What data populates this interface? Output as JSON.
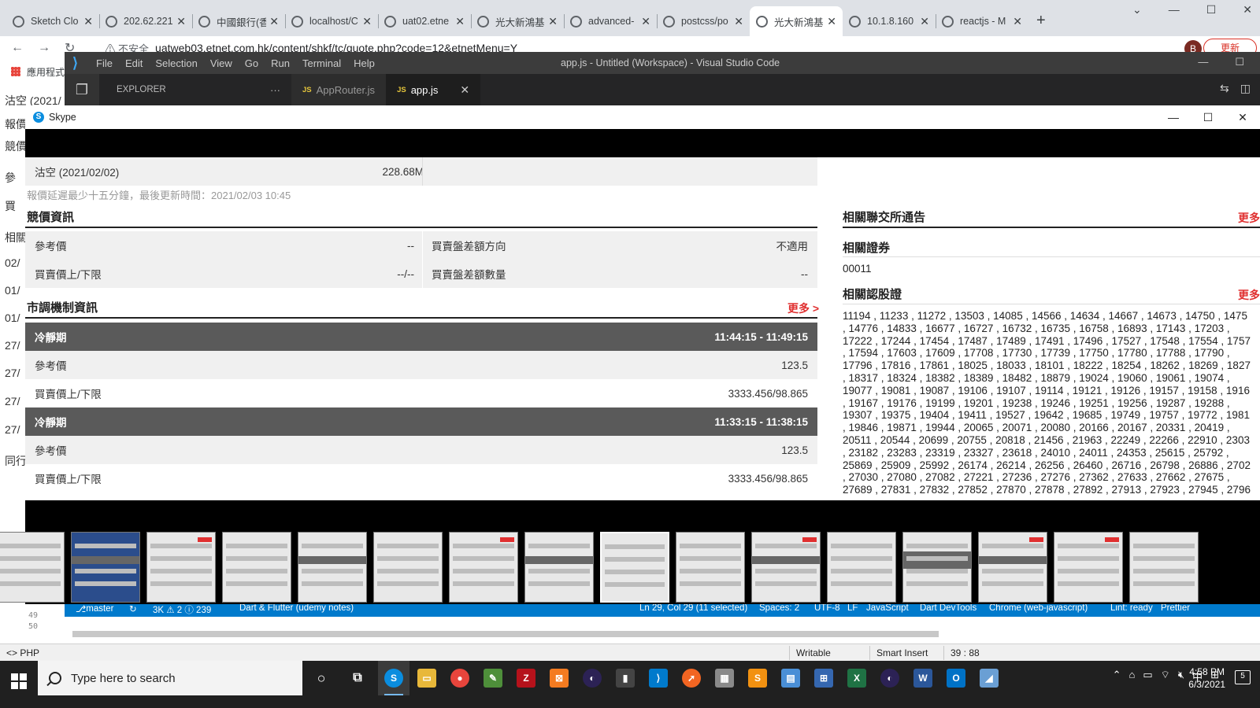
{
  "chrome": {
    "tabs": [
      {
        "title": "Sketch Clo"
      },
      {
        "title": "202.62.221"
      },
      {
        "title": "中國銀行(香"
      },
      {
        "title": "localhost/C"
      },
      {
        "title": "uat02.etne"
      },
      {
        "title": "光大新鴻基"
      },
      {
        "title": "advanced-"
      },
      {
        "title": "postcss/po"
      },
      {
        "title": "光大新鴻基",
        "active": true
      },
      {
        "title": "10.1.8.160"
      },
      {
        "title": "reactjs - M"
      }
    ],
    "new_tab": "+",
    "insecure_label": "不安全",
    "url": "uatweb03.etnet.com.hk/content/shkf/tc/quote.php?code=12&etnetMenu=Y",
    "profile_initial": "B",
    "update_label": "更新",
    "bookmark_apps": "應用程式"
  },
  "background_page": {
    "lines": [
      "沽空 (2021/",
      "報價",
      "競價",
      "參",
      "買",
      "相關",
      "02/",
      "01/",
      "01/",
      "27/",
      "27/",
      "27/",
      "27/",
      "同行"
    ]
  },
  "vscode": {
    "menu": [
      "File",
      "Edit",
      "Selection",
      "View",
      "Go",
      "Run",
      "Terminal",
      "Help"
    ],
    "title": "app.js - Untitled (Workspace) - Visual Studio Code",
    "explorer_label": "EXPLORER",
    "explorer_more": "···",
    "tabs": [
      {
        "badge": "JS",
        "label": "AppRouter.js"
      },
      {
        "badge": "JS",
        "label": "app.js",
        "active": true
      }
    ],
    "gutter_lines": [
      "49",
      "50"
    ],
    "status": {
      "branch": "master",
      "problems": "3K ⚠ 2 ⓘ 239",
      "project": "Dart & Flutter (udemy notes)",
      "cursor": "Ln 29, Col 29 (11 selected)",
      "spaces": "Spaces: 2",
      "encoding": "UTF-8",
      "eol": "LF",
      "language": "JavaScript",
      "devtools": "Dart DevTools",
      "debug": "Chrome (web-javascript)",
      "lint": "Lint: ready",
      "prettier": "Prettier"
    }
  },
  "php_status": {
    "language": "PHP",
    "writable": "Writable",
    "insert_mode": "Smart Insert",
    "position": "39 : 88"
  },
  "skype": {
    "title": "Skype",
    "shared": {
      "short_sell": {
        "label": "沽空 (2021/02/02)",
        "value": "228.68M"
      },
      "delay_note": "報價延遲最少十五分鐘，最後更新時間：2021/02/03 10:45",
      "auction": {
        "title": "競價資訊",
        "rows": [
          {
            "left_label": "參考價",
            "left_value": "--",
            "right_label": "買賣盤差額方向",
            "right_value": "不適用"
          },
          {
            "left_label": "買賣價上/下限",
            "left_value": "--/--",
            "right_label": "買賣盤差額數量",
            "right_value": "--"
          }
        ]
      },
      "vcm": {
        "title": "市調機制資訊",
        "more": "更多 >",
        "blocks": [
          {
            "period_label": "冷靜期",
            "period": "11:44:15 - 11:49:15",
            "ref_label": "參考價",
            "ref": "123.5",
            "limit_label": "買賣價上/下限",
            "limit": "3333.456/98.865"
          },
          {
            "period_label": "冷靜期",
            "period": "11:33:15 - 11:38:15",
            "ref_label": "參考價",
            "ref": "123.5",
            "limit_label": "買賣價上/下限",
            "limit": "3333.456/98.865"
          }
        ]
      },
      "exchange_notice": {
        "title": "相關聯交所通告",
        "more": "更多"
      },
      "related_securities": {
        "title": "相關證券",
        "value": "00011"
      },
      "related_warrants": {
        "title": "相關認股證",
        "more": "更多",
        "text": "11194 , 11233 , 11272 , 13503 , 14085 , 14566 , 14634 , 14667 , 14673 , 14750 , 1475\n, 14776 , 14833 , 16677 , 16727 , 16732 , 16735 , 16758 , 16893 , 17143 , 17203 ,\n17222 , 17244 , 17454 , 17487 , 17489 , 17491 , 17496 , 17527 , 17548 , 17554 , 1757\n, 17594 , 17603 , 17609 , 17708 , 17730 , 17739 , 17750 , 17780 , 17788 , 17790 ,\n17796 , 17816 , 17861 , 18025 , 18033 , 18101 , 18222 , 18254 , 18262 , 18269 , 1827\n, 18317 , 18324 , 18382 , 18389 , 18482 , 18879 , 19024 , 19060 , 19061 , 19074 ,\n19077 , 19081 , 19087 , 19106 , 19107 , 19114 , 19121 , 19126 , 19157 , 19158 , 1916\n, 19167 , 19176 , 19199 , 19201 , 19238 , 19246 , 19251 , 19256 , 19287 , 19288 ,\n19307 , 19375 , 19404 , 19411 , 19527 , 19642 , 19685 , 19749 , 19757 , 19772 , 1981\n, 19846 , 19871 , 19944 , 20065 , 20071 , 20080 , 20166 , 20167 , 20331 , 20419 ,\n20511 , 20544 , 20699 , 20755 , 20818 , 21456 , 21963 , 22249 , 22266 , 22910 , 2303\n, 23182 , 23283 , 23319 , 23327 , 23618 , 24010 , 24011 , 24353 , 25615 , 25792 ,\n25869 , 25909 , 25992 , 26174 , 26214 , 26256 , 26460 , 26716 , 26798 , 26886 , 2702\n, 27030 , 27080 , 27082 , 27221 , 27236 , 27276 , 27362 , 27633 , 27662 , 27675 ,\n27689 , 27831 , 27832 , 27852 , 27870 , 27878 , 27892 , 27913 , 27923 , 27945 , 2796"
      }
    },
    "thumbnail_count": 16,
    "selected_thumbnail": 8
  },
  "taskbar": {
    "search_placeholder": "Type here to search",
    "time": "4:58 PM",
    "date": "6/3/2021",
    "notification_count": "5",
    "ime_label": "中"
  },
  "colors": {
    "accent_red": "#e03030",
    "vscode_status_blue": "#007acc",
    "skype_blue": "#0a8ddf"
  }
}
